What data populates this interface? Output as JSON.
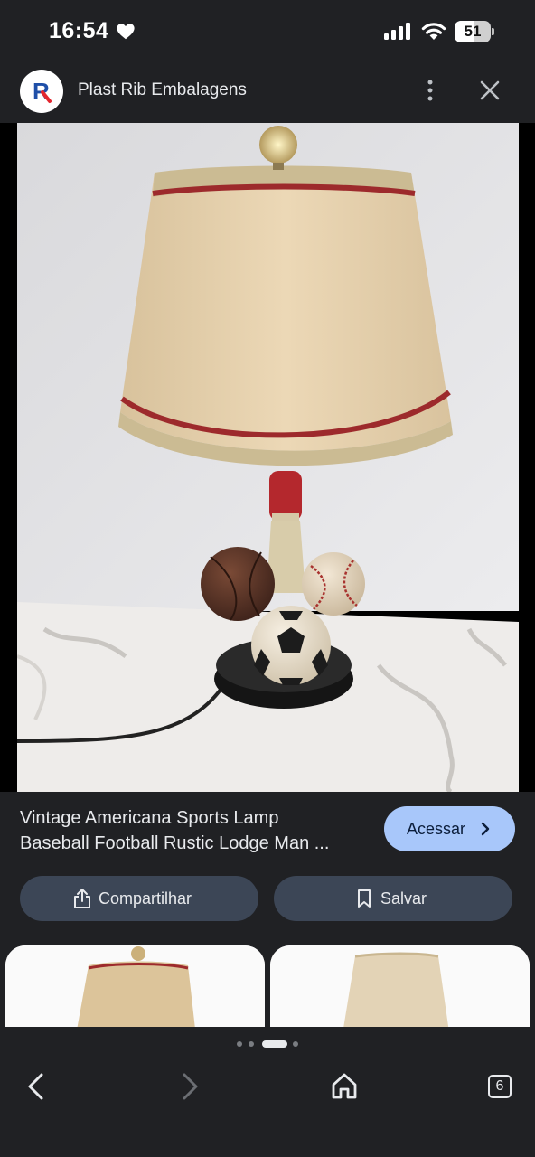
{
  "status_bar": {
    "time": "16:54",
    "battery": "51",
    "icons": [
      "heart-icon",
      "cellular-signal-icon",
      "wifi-icon",
      "battery-icon"
    ]
  },
  "header": {
    "logo_letter": "R",
    "site_name": "Plast Rib Embalagens",
    "icons": [
      "more-vertical-icon",
      "close-icon"
    ]
  },
  "product": {
    "image_subject": "sports-lamp-image",
    "title_line1": "Vintage Americana Sports Lamp",
    "title_line2": "Baseball Football Rustic Lodge Man ..."
  },
  "actions": {
    "visit_label": "Acessar",
    "share_label": "Compartilhar",
    "save_label": "Salvar"
  },
  "related": {
    "cards": [
      "related-lamp-card",
      "related-lampshade-card"
    ]
  },
  "bottom_nav": {
    "pagination": {
      "count": 4,
      "active_index": 2
    },
    "tab_count": "6",
    "icons": [
      "back-arrow-icon",
      "forward-arrow-icon",
      "home-icon",
      "tabs-icon"
    ]
  },
  "colors": {
    "background": "#202124",
    "accent_button": "#a8c7fa",
    "pill_button": "#3c4656",
    "logo_red": "#e3262f",
    "logo_blue": "#1f4fa8"
  }
}
